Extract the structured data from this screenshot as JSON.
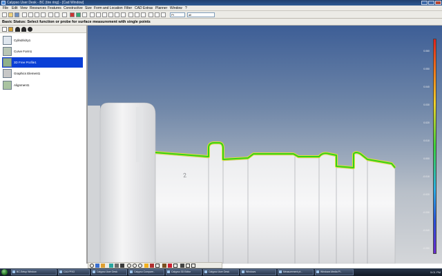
{
  "window": {
    "title": "Calypso User Desk - BC (tire ring) - [Cad Window]"
  },
  "menubar": {
    "items": [
      "File",
      "Edit",
      "View",
      "Resources",
      "Features",
      "Constructive",
      "Size",
      "Form and Location",
      "Filter",
      "CAD",
      "Extras",
      "Planner",
      "Window",
      "?"
    ]
  },
  "toolbar": {
    "dropdown_value": "Pt",
    "dropdown2_value": "all"
  },
  "status": {
    "text": "Basic Status: Select function or probe for surface measurement with single points"
  },
  "features": [
    {
      "label": "Cylindricity1",
      "icon": "cylinder-icon"
    },
    {
      "label": "Curve Form1",
      "icon": "curve-icon"
    },
    {
      "label": "3D Free Profile1",
      "icon": "profile-icon",
      "selected": true
    },
    {
      "label": "Graphics Element1",
      "icon": "graphics-icon"
    },
    {
      "label": "Alignment1",
      "icon": "alignment-icon"
    }
  ],
  "viewport": {
    "part_engraving": "2",
    "scale_labels": [
      "0.060",
      "0.050",
      "0.040",
      "0.030",
      "0.020",
      "0.010",
      "0.000",
      "-0.010",
      "-0.020",
      "-0.030",
      "-0.040",
      "-0.050",
      "-0.060"
    ]
  },
  "taskbar": {
    "tasks": [
      "BC-Setup Window",
      "CALYPSO",
      "Calypso User Desk",
      "Calypso Compare..",
      "Calypso 3D Editor",
      "Calypso User Desk",
      "Windows",
      "Measurement pt...",
      "Windows Media Pl.."
    ],
    "clock": "5:01 PM"
  },
  "colors": {
    "selection": "#0a3fd6",
    "measure_green": "#32d01a",
    "measure_yellow": "#e8e62a",
    "viewport_top": "#3d5e96",
    "viewport_bottom": "#d4d6d9"
  }
}
